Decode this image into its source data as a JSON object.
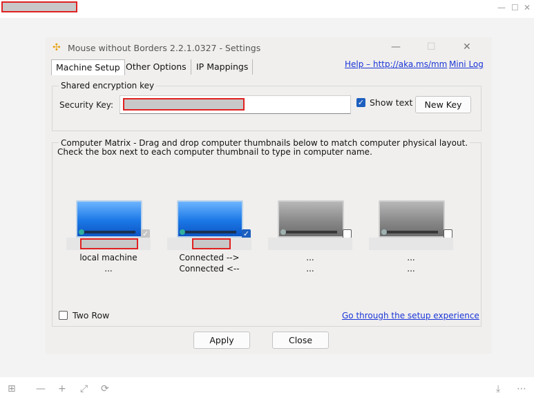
{
  "viewer": {
    "controls": {
      "minimize": "—",
      "maximize": "☐",
      "close": "✕"
    },
    "bottom_icons": {
      "grid": "⊞",
      "zoom_out": "—",
      "zoom_in": "+",
      "fit": "⤢",
      "rotate": "⟳",
      "download": "⤓",
      "more": "⋯"
    }
  },
  "dialog": {
    "title": "Mouse without Borders 2.2.1.0327 - Settings",
    "title_icon": "✣",
    "controls": {
      "minimize": "—",
      "maximize": "☐",
      "close": "✕"
    },
    "tabs": [
      {
        "label": "Machine Setup",
        "active": true
      },
      {
        "label": "Other Options",
        "active": false
      },
      {
        "label": "IP Mappings",
        "active": false
      }
    ],
    "help_link": "Help – http://aka.ms/mm",
    "mini_log_link": "Mini Log",
    "encryption": {
      "legend": "Shared encryption key",
      "security_key_label": "Security Key:",
      "show_text_label": "Show text",
      "show_text_checked": true,
      "new_key_button": "New Key"
    },
    "matrix": {
      "legend": "Computer Matrix  - Drag and drop computer thumbnails below to match computer physical layout.",
      "instruction": "Check the box next to each computer thumbnail to type in computer name.",
      "machines": [
        {
          "status1": "local machine",
          "status2": "...",
          "checked": true,
          "enabled": false,
          "active": true
        },
        {
          "status1": "Connected -->",
          "status2": "Connected <--",
          "checked": true,
          "enabled": true,
          "active": true
        },
        {
          "status1": "...",
          "status2": "...",
          "checked": false,
          "enabled": true,
          "active": false
        },
        {
          "status1": "...",
          "status2": "...",
          "checked": false,
          "enabled": true,
          "active": false
        }
      ],
      "two_row_label": "Two Row",
      "two_row_checked": false,
      "setup_link": "Go through the setup experience"
    },
    "buttons": {
      "apply": "Apply",
      "close": "Close"
    }
  },
  "colors": {
    "link": "#1a35d8",
    "accent": "#1d5fbf",
    "redaction": "#e02020"
  }
}
